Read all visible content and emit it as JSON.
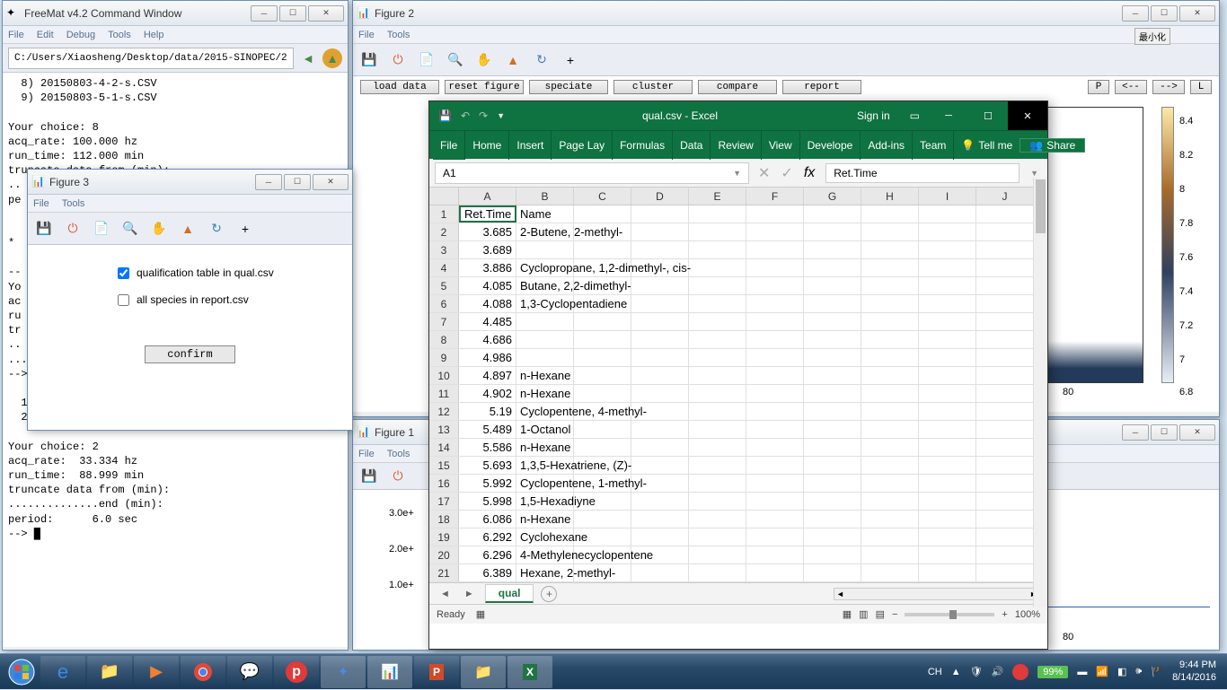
{
  "freemat": {
    "title": "FreeMat v4.2 Command Window",
    "menu": [
      "File",
      "Edit",
      "Debug",
      "Tools",
      "Help"
    ],
    "path": "C:/Users/Xiaosheng/Desktop/data/2015-SINOPEC/2",
    "console_text": "  8) 20150803-4-2-s.CSV\n  9) 20150803-5-1-s.CSV\n\nYour choice: 8\nacq_rate: 100.000 hz\nrun_time: 112.000 min\ntruncate data from (min):\n..\npe\n  \n  \n* \n  \n--\nYo\nac\nru\ntr\n..\n..............end (min): 112\n--> search D/CH/MS/CSV in present directory.\n\n  1) JX-MS-Rxi17-EBTM-addHydrA.csv\n  2) JX-MS-Rxi17-EBTM-sourceA.csv\n\nYour choice: 2\nacq_rate:  33.334 hz\nrun_time:  88.999 min\ntruncate data from (min):\n..............end (min):\nperiod:      6.0 sec\n--> █"
  },
  "figure2": {
    "title": "Figure 2",
    "menu": [
      "File",
      "Tools"
    ],
    "buttons": {
      "load": "load data",
      "reset": "reset figure",
      "speciate": "speciate",
      "cluster": "cluster",
      "compare": "compare",
      "report": "report",
      "p": "P",
      "left": "<--",
      "right": "-->",
      "l": "L"
    },
    "minimize_label": "最小化",
    "axis_tick": "80",
    "cb_ticks": [
      "8.4",
      "8.2",
      "8",
      "7.8",
      "7.6",
      "7.4",
      "7.2",
      "7",
      "6.8"
    ]
  },
  "figure3": {
    "title": "Figure 3",
    "menu": [
      "File",
      "Tools"
    ],
    "check1": "qualification table in qual.csv",
    "check2": "all species in report.csv",
    "confirm": "confirm"
  },
  "figure1": {
    "title": "Figure 1",
    "menu": [
      "File",
      "Tools"
    ],
    "yticks": [
      "3.0e+",
      "2.0e+",
      "1.0e+"
    ],
    "axis_tick": "80"
  },
  "excel": {
    "titlebar": "qual.csv - Excel",
    "signin": "Sign in",
    "share": "Share",
    "tabs": [
      "File",
      "Home",
      "Insert",
      "Page Lay",
      "Formulas",
      "Data",
      "Review",
      "View",
      "Develope",
      "Add-ins",
      "Team"
    ],
    "tellme": "Tell me",
    "namebox": "A1",
    "formula": "Ret.Time",
    "cols": [
      "A",
      "B",
      "C",
      "D",
      "E",
      "F",
      "G",
      "H",
      "I",
      "J"
    ],
    "rows": [
      {
        "n": 1,
        "a": "Ret.Time",
        "b": "Name"
      },
      {
        "n": 2,
        "a": "3.685",
        "b": "2-Butene, 2-methyl-"
      },
      {
        "n": 3,
        "a": "3.689",
        "b": ""
      },
      {
        "n": 4,
        "a": "3.886",
        "b": "Cyclopropane, 1,2-dimethyl-, cis-"
      },
      {
        "n": 5,
        "a": "4.085",
        "b": "Butane, 2,2-dimethyl-"
      },
      {
        "n": 6,
        "a": "4.088",
        "b": "1,3-Cyclopentadiene"
      },
      {
        "n": 7,
        "a": "4.485",
        "b": ""
      },
      {
        "n": 8,
        "a": "4.686",
        "b": ""
      },
      {
        "n": 9,
        "a": "4.986",
        "b": ""
      },
      {
        "n": 10,
        "a": "4.897",
        "b": "n-Hexane"
      },
      {
        "n": 11,
        "a": "4.902",
        "b": "n-Hexane"
      },
      {
        "n": 12,
        "a": "5.19",
        "b": "Cyclopentene, 4-methyl-"
      },
      {
        "n": 13,
        "a": "5.489",
        "b": "1-Octanol"
      },
      {
        "n": 14,
        "a": "5.586",
        "b": "n-Hexane"
      },
      {
        "n": 15,
        "a": "5.693",
        "b": "1,3,5-Hexatriene, (Z)-"
      },
      {
        "n": 16,
        "a": "5.992",
        "b": "Cyclopentene, 1-methyl-"
      },
      {
        "n": 17,
        "a": "5.998",
        "b": "1,5-Hexadiyne"
      },
      {
        "n": 18,
        "a": "6.086",
        "b": "n-Hexane"
      },
      {
        "n": 19,
        "a": "6.292",
        "b": "Cyclohexane"
      },
      {
        "n": 20,
        "a": "6.296",
        "b": "4-Methylenecyclopentene"
      },
      {
        "n": 21,
        "a": "6.389",
        "b": "Hexane, 2-methyl-"
      }
    ],
    "sheet": "qual",
    "status": "Ready",
    "zoom": "100%"
  },
  "taskbar": {
    "lang": "CH",
    "battery": "99%",
    "time": "9:44 PM",
    "date": "8/14/2016"
  }
}
